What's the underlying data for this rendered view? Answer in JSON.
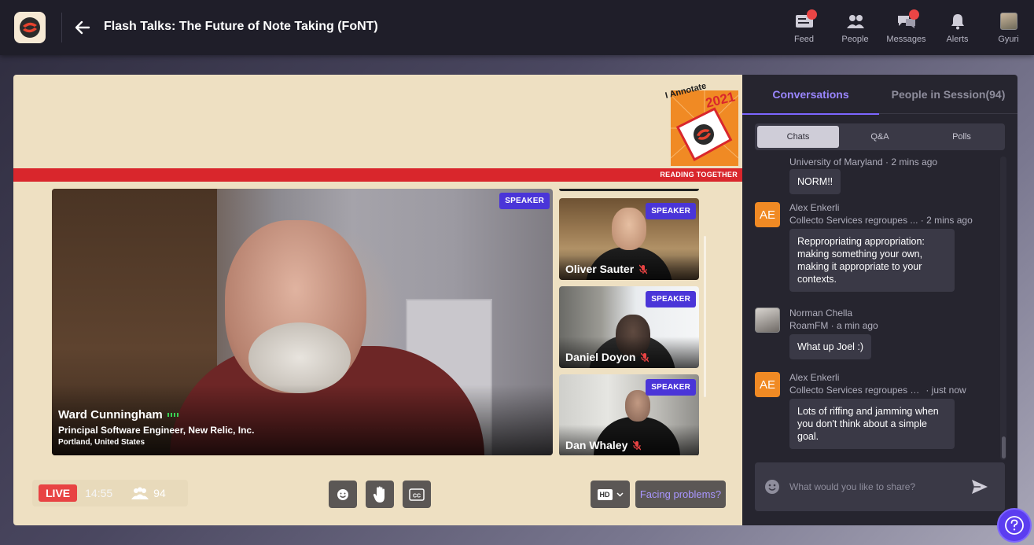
{
  "header": {
    "event_title": "Flash Talks: The Future of Note Taking (FoNT)",
    "nav": [
      {
        "label": "Feed",
        "icon": "feed-icon",
        "badge": true
      },
      {
        "label": "People",
        "icon": "people-icon",
        "badge": false
      },
      {
        "label": "Messages",
        "icon": "messages-icon",
        "badge": true
      },
      {
        "label": "Alerts",
        "icon": "bell-icon",
        "badge": false
      },
      {
        "label": "Gyuri",
        "icon": "profile-avatar",
        "badge": false
      }
    ]
  },
  "banner": {
    "logo_title": "I Annotate",
    "logo_year": "2021",
    "tagline": "READING TOGETHER"
  },
  "stage": {
    "main_speaker": {
      "badge": "SPEAKER",
      "name": "Ward Cunningham",
      "role": "Principal Software Engineer, New Relic, Inc.",
      "location": "Portland, United States"
    },
    "speakers": [
      {
        "name": "Oliver Sauter",
        "badge": "SPEAKER",
        "muted": true
      },
      {
        "name": "Daniel Doyon",
        "badge": "SPEAKER",
        "muted": true
      },
      {
        "name": "Dan Whaley",
        "badge": "SPEAKER",
        "muted": true
      }
    ],
    "controls": {
      "live_label": "LIVE",
      "timer": "14:55",
      "viewers": "94",
      "quality": "HD",
      "problems_label": "Facing problems?"
    }
  },
  "panel": {
    "tabs": [
      "Conversations",
      "People in Session(94)"
    ],
    "active_tab": "Conversations",
    "segments": [
      "Chats",
      "Q&A",
      "Polls"
    ],
    "active_segment": "Chats",
    "messages": [
      {
        "org": "University of Maryland",
        "time": "2 mins ago",
        "text": "NORM!!"
      },
      {
        "initials": "AE",
        "name": "Alex Enkerli",
        "org": "Collecto Services regroupes ...",
        "time": "2 mins ago",
        "text": "Reppropriating appropriation: making something your own, making it appropriate to your contexts."
      },
      {
        "name": "Norman Chella",
        "org": "RoamFM",
        "time": "a min ago",
        "text": "What up Joel :)"
      },
      {
        "initials": "AE",
        "name": "Alex Enkerli",
        "org": "Collecto Services regroupes en...",
        "time": "just now",
        "text": "Lots of riffing and jamming when you don't think about a simple goal."
      }
    ],
    "composer_placeholder": "What would you like to share?"
  },
  "colors": {
    "accent": "#7c66ff",
    "live_red": "#e84343",
    "banner_red": "#d9262c",
    "stage_bg": "#eee0c2",
    "panel_bg": "#26252f",
    "avatar_orange": "#f08a24"
  }
}
